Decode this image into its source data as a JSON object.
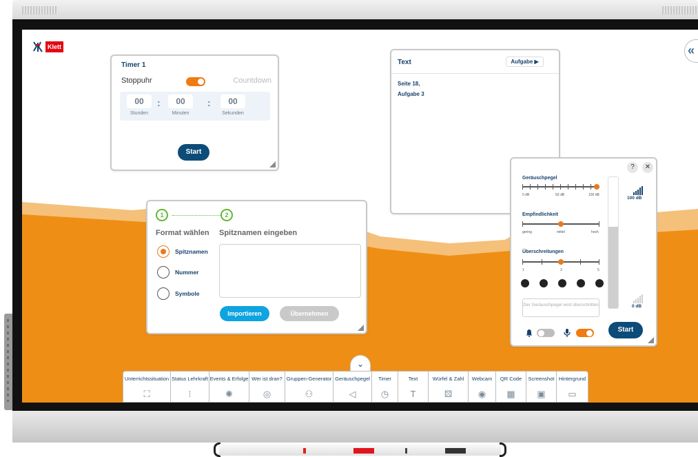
{
  "colors": {
    "orange": "#ef8e15",
    "light_orange": "#f5c07a",
    "dark_blue": "#0d4b78",
    "green": "#5fb833",
    "accent_orange": "#e97a1e",
    "import_blue": "#0fa3e0"
  },
  "logo": {
    "text": "Klett",
    "mark": "klett-mark-icon"
  },
  "sidebar": {
    "collapse_glyph": "«"
  },
  "timer": {
    "title": "Timer 1",
    "mode_left": "Stoppuhr",
    "mode_right": "Countdown",
    "hours": "00",
    "minutes": "00",
    "seconds": "00",
    "sep": ":",
    "hours_label": "Stunden",
    "minutes_label": "Minuten",
    "seconds_label": "Sekunden",
    "start_label": "Start"
  },
  "text_widget": {
    "title": "Text",
    "task_button": "Aufgabe ▶",
    "line1": "Seite 18,",
    "line2": "Aufgabe 3"
  },
  "group_generator": {
    "step1_num": "1",
    "step2_num": "2",
    "step1_label": "Format wählen",
    "step2_label": "Spitznamen eingeben",
    "options": [
      {
        "label": "Spitznamen",
        "selected": true
      },
      {
        "label": "Nummer",
        "selected": false
      },
      {
        "label": "Symbole",
        "selected": false
      }
    ],
    "import_label": "Importieren",
    "apply_label": "Übernehmen"
  },
  "noise": {
    "help": "?",
    "close": "✕",
    "level_title": "Geräuschpegel",
    "level_min": "0 dB",
    "level_mid": "50 dB",
    "level_max": "100 dB",
    "sensitivity_title": "Empfindlichkeit",
    "sens_low": "gering",
    "sens_mid": "mittel",
    "sens_high": "hoch",
    "exceed_title": "Überschreitungen",
    "exceed_min": "1",
    "exceed_mid": "3",
    "exceed_max": "5",
    "level_value_pct": 100,
    "sensitivity_value_pct": 50,
    "exceed_value_pct": 50,
    "meter_top": "100 dB",
    "meter_bottom": "0 dB",
    "warning_text": "Der Geräuschpegel wird überschritten",
    "bell_icon": "bell-icon",
    "mic_icon": "microphone-icon",
    "start_label": "Start"
  },
  "toolbar": {
    "toggle_glyph": "⌄",
    "tools": [
      {
        "label": "Unterrichtssituation",
        "icon": "classroom-icon",
        "glyph": "⛶",
        "w": 70
      },
      {
        "label": "Status Lehrkraft",
        "icon": "traffic-light-icon",
        "glyph": "⁝",
        "w": 56
      },
      {
        "label": "Events & Erfolge",
        "icon": "celebration-icon",
        "glyph": "✺",
        "w": 58
      },
      {
        "label": "Wer ist dran?",
        "icon": "picker-icon",
        "glyph": "◎",
        "w": 52
      },
      {
        "label": "Gruppen-Generator",
        "icon": "group-icon",
        "glyph": "⚇",
        "w": 70
      },
      {
        "label": "Geräuschpegel",
        "icon": "megaphone-icon",
        "glyph": "◁",
        "w": 56
      },
      {
        "label": "Timer",
        "icon": "clock-icon",
        "glyph": "◷",
        "w": 38
      },
      {
        "label": "Text",
        "icon": "text-icon",
        "glyph": "T",
        "w": 44
      },
      {
        "label": "Würfel & Zahl",
        "icon": "dice-icon",
        "glyph": "⚄",
        "w": 58
      },
      {
        "label": "Webcam",
        "icon": "webcam-icon",
        "glyph": "◉",
        "w": 40
      },
      {
        "label": "QR Code",
        "icon": "qr-code-icon",
        "glyph": "▦",
        "w": 44
      },
      {
        "label": "Screenshot",
        "icon": "screenshot-icon",
        "glyph": "▣",
        "w": 44
      },
      {
        "label": "Hintergrund",
        "icon": "background-icon",
        "glyph": "▭",
        "w": 46
      }
    ]
  }
}
